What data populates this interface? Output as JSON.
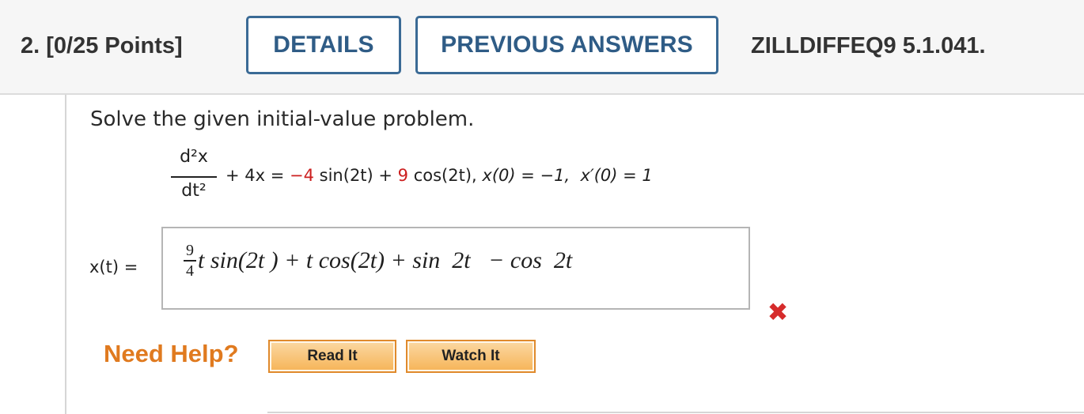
{
  "header": {
    "question_label": "2.  [0/25 Points]",
    "details_label": "DETAILS",
    "previous_answers_label": "PREVIOUS ANSWERS",
    "problem_code": "ZILLDIFFEQ9 5.1.041."
  },
  "problem": {
    "prompt": "Solve the given initial-value problem.",
    "fraction_numerator": "d²x",
    "fraction_denominator": "dt²",
    "equation_part1": "+ 4x = ",
    "coef_sin": "−4",
    "sin_term": " sin(2t) + ",
    "coef_cos": "9",
    "cos_term": " cos(2t), ",
    "init_x": "x(0) = −1,",
    "init_xprime": "x′(0) = 1"
  },
  "answer": {
    "label": "x(t) =",
    "frac_num": "9",
    "frac_den": "4",
    "expression": "t sin(2t ) + t cos(2t) + sin  2t   − cos  2t",
    "status_icon": "x-mark-icon",
    "status": "incorrect"
  },
  "help": {
    "label": "Need Help?",
    "read_it": "Read It",
    "watch_it": "Watch It"
  },
  "colors": {
    "accent": "#2f5c86",
    "error": "#d62b2b",
    "help_orange": "#e07a1f"
  }
}
